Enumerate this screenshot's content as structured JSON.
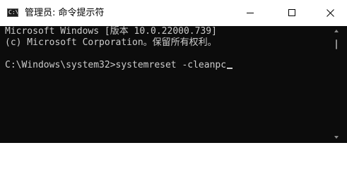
{
  "window": {
    "title": "管理员: 命令提示符",
    "icon": "command-prompt-icon",
    "background_color": "#0c0c0c",
    "text_color": "#cccccc"
  },
  "controls": {
    "minimize_icon": "minimize-icon",
    "maximize_icon": "maximize-icon",
    "close_icon": "close-icon"
  },
  "console": {
    "lines": [
      "Microsoft Windows [版本 10.0.22000.739]",
      "(c) Microsoft Corporation。保留所有权利。",
      "",
      "C:\\Windows\\system32>systemreset -cleanpc"
    ]
  }
}
